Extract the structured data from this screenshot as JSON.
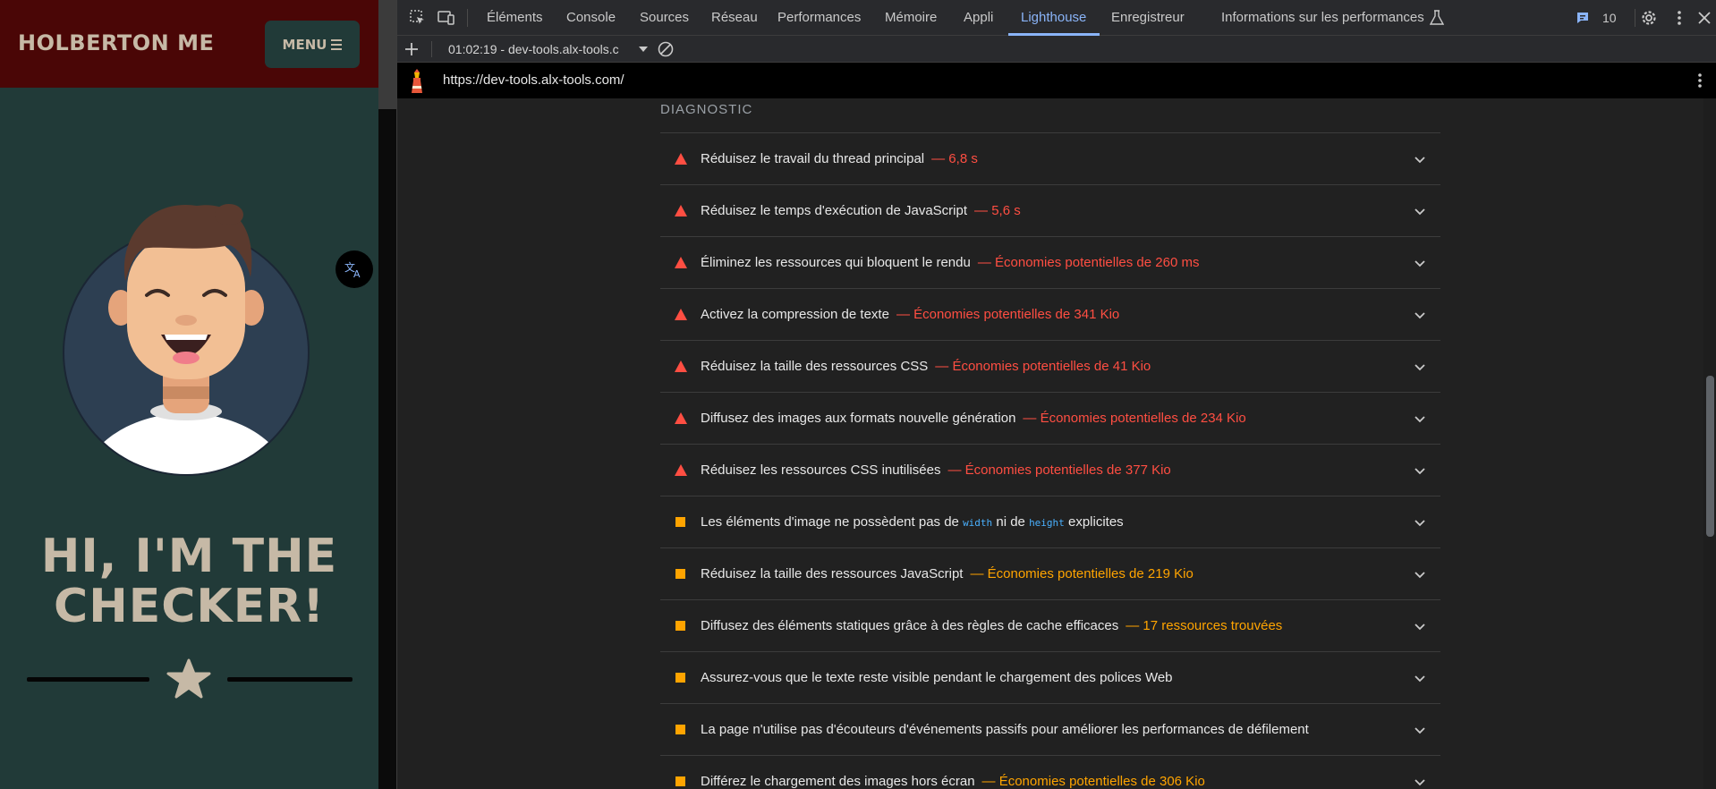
{
  "site": {
    "logo": "HOLBERTON ME",
    "menu_label": "MENU",
    "hero_line1": "HI, I'M THE",
    "hero_line2": "CHECKER!",
    "colors": {
      "header_bg": "#4a0606",
      "page_bg": "#213a38",
      "accent_text": "#c6b9a6"
    }
  },
  "devtools": {
    "tabs": [
      {
        "label": "Éléments"
      },
      {
        "label": "Console"
      },
      {
        "label": "Sources"
      },
      {
        "label": "Réseau"
      },
      {
        "label": "Performances"
      },
      {
        "label": "Mémoire"
      },
      {
        "label": "Appli"
      },
      {
        "label": "Lighthouse",
        "active": true
      },
      {
        "label": "Enregistreur"
      },
      {
        "label": "Informations sur les performances"
      }
    ],
    "issues_count": "10",
    "report_selector": "01:02:19 - dev-tools.alx-tools.c",
    "url": "https://dev-tools.alx-tools.com/",
    "section_title": "DIAGNOSTIC",
    "audits": [
      {
        "status": "fail",
        "title": "Réduisez le travail du thread principal",
        "display": "— 6,8 s"
      },
      {
        "status": "fail",
        "title": "Réduisez le temps d'exécution de JavaScript",
        "display": "— 5,6 s"
      },
      {
        "status": "fail",
        "title": "Éliminez les ressources qui bloquent le rendu",
        "display": "— Économies potentielles de 260 ms"
      },
      {
        "status": "fail",
        "title": "Activez la compression de texte",
        "display": "— Économies potentielles de 341 Kio"
      },
      {
        "status": "fail",
        "title": "Réduisez la taille des ressources CSS",
        "display": "— Économies potentielles de 41 Kio"
      },
      {
        "status": "fail",
        "title": "Diffusez des images aux formats nouvelle génération",
        "display": "— Économies potentielles de 234 Kio"
      },
      {
        "status": "fail",
        "title": "Réduisez les ressources CSS inutilisées",
        "display": "— Économies potentielles de 377 Kio"
      },
      {
        "status": "avg",
        "title_pre": "Les éléments d'image ne possèdent pas de",
        "code1": "width",
        "title_mid": "ni de",
        "code2": "height",
        "title_post": "explicites"
      },
      {
        "status": "avg",
        "title": "Réduisez la taille des ressources JavaScript",
        "display": "— Économies potentielles de 219 Kio"
      },
      {
        "status": "avg",
        "title": "Diffusez des éléments statiques grâce à des règles de cache efficaces",
        "display": "— 17 ressources trouvées"
      },
      {
        "status": "avg",
        "title": "Assurez-vous que le texte reste visible pendant le chargement des polices Web"
      },
      {
        "status": "avg",
        "title": "La page n'utilise pas d'écouteurs d'événements passifs pour améliorer les performances de défilement"
      },
      {
        "status": "avg",
        "title": "Différez le chargement des images hors écran",
        "display": "— Économies potentielles de 306 Kio"
      }
    ],
    "colors": {
      "accent": "#8ab4f8",
      "fail": "#ff4e42",
      "average": "#ffa400"
    },
    "icons": [
      "inspect-element-icon",
      "device-toolbar-icon",
      "flask-icon",
      "issues-icon",
      "settings-gear-icon",
      "kebab-menu-icon",
      "close-icon",
      "plus-icon",
      "dropdown-arrow-icon",
      "clear-block-icon",
      "lighthouse-icon",
      "chevron-down-icon"
    ]
  }
}
